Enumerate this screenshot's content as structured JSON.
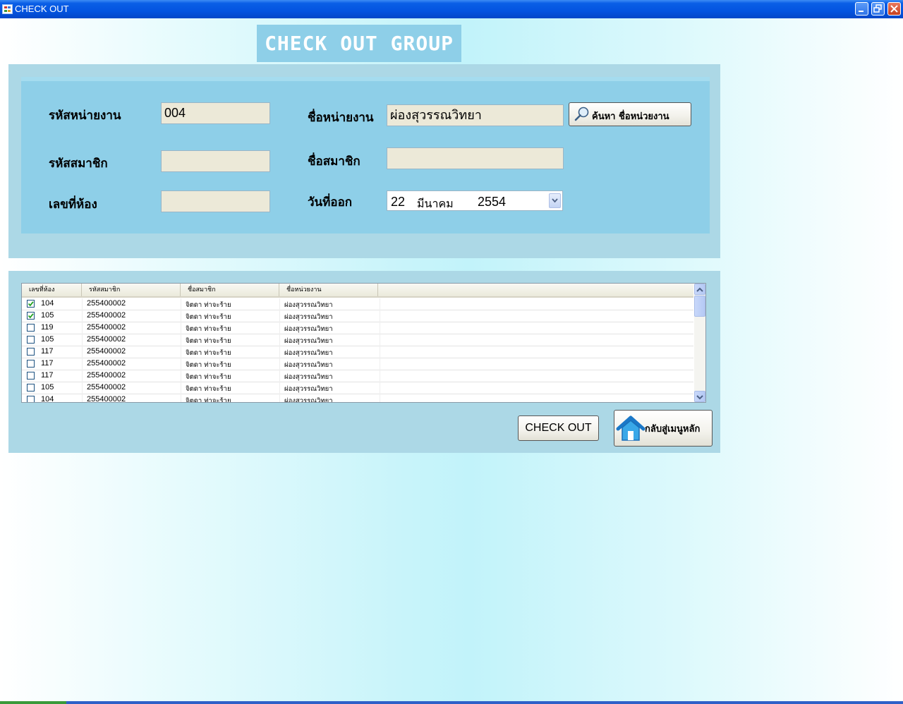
{
  "window": {
    "title": "CHECK OUT"
  },
  "header": {
    "title": "CHECK OUT GROUP"
  },
  "form": {
    "dept_code_label": "รหัสหน่ายงาน",
    "dept_code_value": "004",
    "dept_name_label": "ชื่อหน่ายงาน",
    "dept_name_value": "ผ่องสุวรรณวิทยา",
    "search_button_label": "ค้นหา ชื่อหน่วยงาน",
    "member_code_label": "รหัสสมาชิก",
    "member_code_value": "",
    "member_name_label": "ชื่อสมาชิก",
    "member_name_value": "",
    "room_no_label": "เลขที่ห้อง",
    "room_no_value": "",
    "checkout_date_label": "วันที่ออก",
    "checkout_date": {
      "day": "22",
      "month": "มีนาคม",
      "year": "2554"
    }
  },
  "grid": {
    "columns": [
      "เลขที่ห้อง",
      "รหัสสมาชิก",
      "ชื่อสมาชิก",
      "ชื่อหน่วยงาน"
    ],
    "rows": [
      {
        "checked": true,
        "room": "104",
        "member_code": "255400002",
        "member_name": "จิตดา ท่าจะร้าย",
        "dept_name": "ผ่องสุวรรณวิทยา"
      },
      {
        "checked": true,
        "room": "105",
        "member_code": "255400002",
        "member_name": "จิตดา ท่าจะร้าย",
        "dept_name": "ผ่องสุวรรณวิทยา"
      },
      {
        "checked": false,
        "room": "119",
        "member_code": "255400002",
        "member_name": "จิตดา ท่าจะร้าย",
        "dept_name": "ผ่องสุวรรณวิทยา"
      },
      {
        "checked": false,
        "room": "105",
        "member_code": "255400002",
        "member_name": "จิตดา ท่าจะร้าย",
        "dept_name": "ผ่องสุวรรณวิทยา"
      },
      {
        "checked": false,
        "room": "117",
        "member_code": "255400002",
        "member_name": "จิตดา ท่าจะร้าย",
        "dept_name": "ผ่องสุวรรณวิทยา"
      },
      {
        "checked": false,
        "room": "117",
        "member_code": "255400002",
        "member_name": "จิตดา ท่าจะร้าย",
        "dept_name": "ผ่องสุวรรณวิทยา"
      },
      {
        "checked": false,
        "room": "117",
        "member_code": "255400002",
        "member_name": "จิตดา ท่าจะร้าย",
        "dept_name": "ผ่องสุวรรณวิทยา"
      },
      {
        "checked": false,
        "room": "105",
        "member_code": "255400002",
        "member_name": "จิตดา ท่าจะร้าย",
        "dept_name": "ผ่องสุวรรณวิทยา"
      },
      {
        "checked": false,
        "room": "104",
        "member_code": "255400002",
        "member_name": "จิตดา ท่าจะร้าย",
        "dept_name": "ผ่องสุวรรณวิทยา"
      }
    ]
  },
  "actions": {
    "checkout_label": "CHECK OUT",
    "home_label": "กลับสู่เมนูหลัก"
  },
  "icons": {
    "window": "app-window-icon",
    "search": "magnifier-icon",
    "home": "home-icon",
    "dropdown": "chevron-down-icon"
  }
}
